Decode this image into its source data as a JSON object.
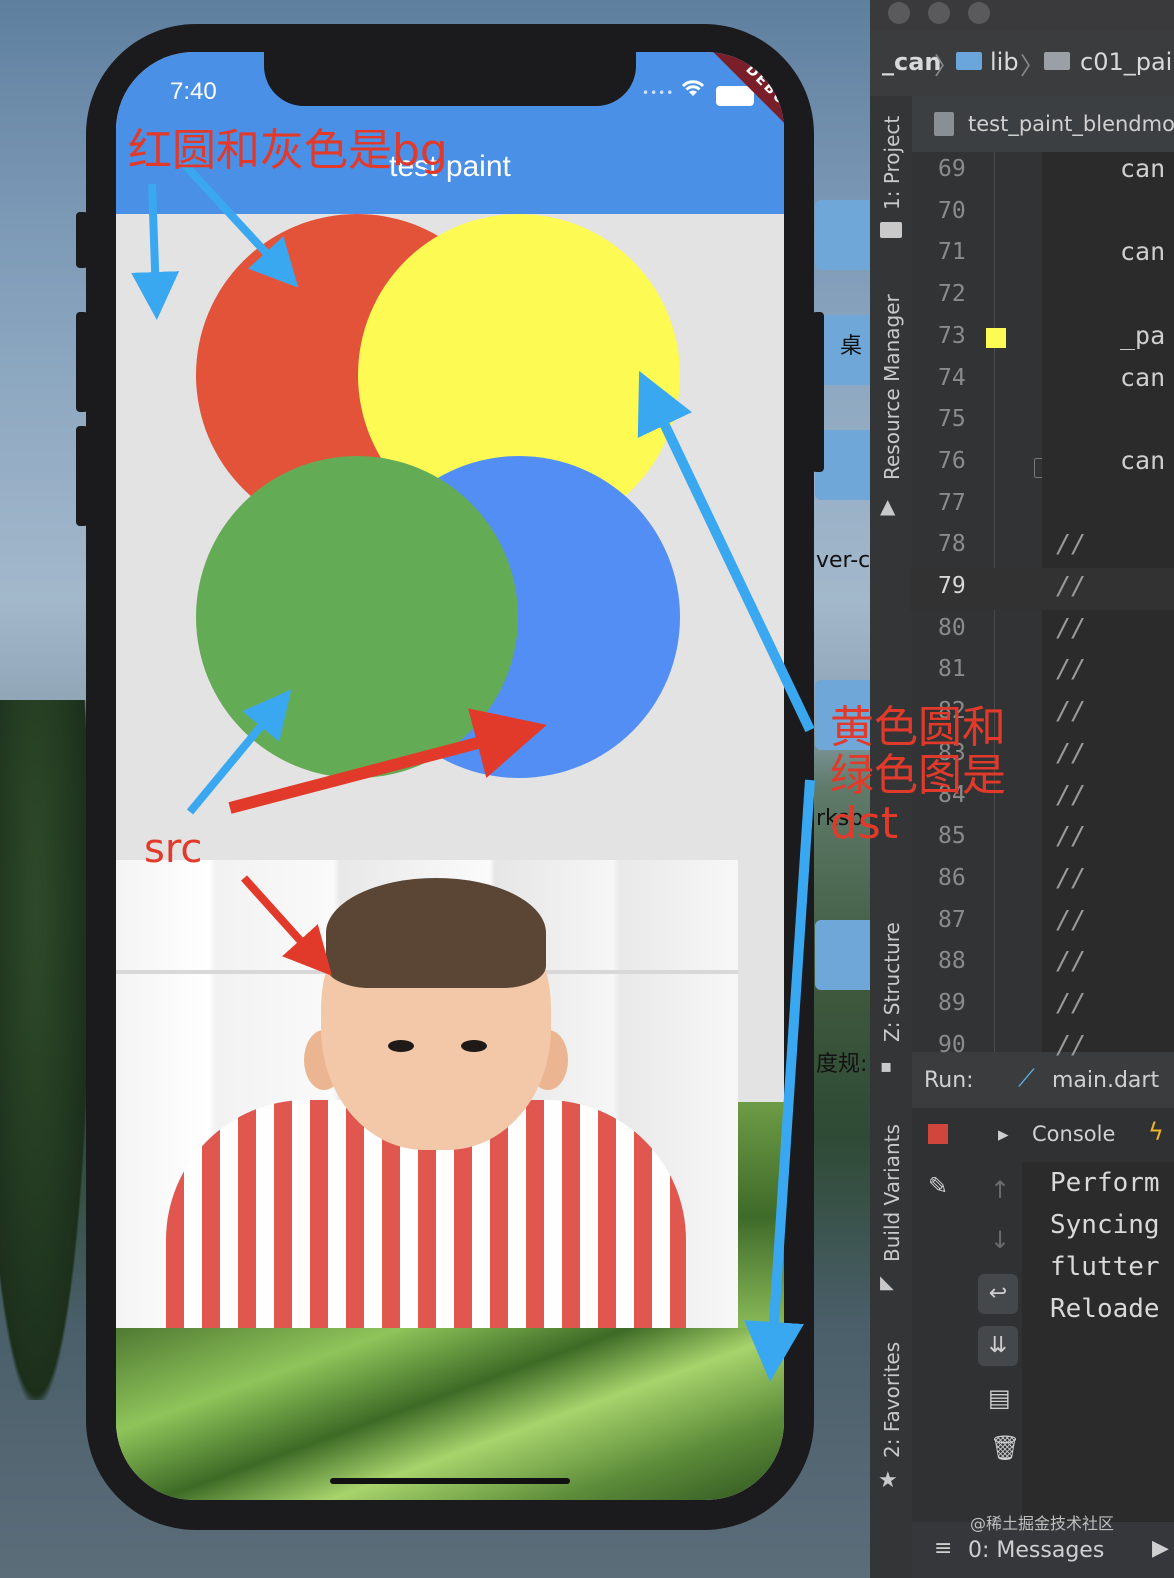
{
  "phone": {
    "status_time": "7:40",
    "debug_banner": "DEBUG",
    "app_title": "test paint"
  },
  "annotations": {
    "bg_note": "红圆和灰色是bg",
    "src_note": "src",
    "dst_note_line1": "黄色圆和",
    "dst_note_line2": "绿色图是",
    "dst_note_line3": "dst"
  },
  "desktop_labels": {
    "label_1": "桌",
    "label_2": "ver-c",
    "label_3": "rksp",
    "label_4": "度规:"
  },
  "ide": {
    "breadcrumb": [
      "_can",
      "lib",
      "c01_pai"
    ],
    "file_tab": "test_paint_blendmo",
    "side_tabs": {
      "project": "1: Project",
      "resource_manager": "Resource Manager",
      "structure": "Z: Structure",
      "build_variants": "Build Variants",
      "favorites": "2: Favorites"
    },
    "line_numbers": [
      "69",
      "70",
      "71",
      "72",
      "73",
      "74",
      "75",
      "76",
      "77",
      "78",
      "79",
      "80",
      "81",
      "82",
      "83",
      "84",
      "85",
      "86",
      "87",
      "88",
      "89",
      "90"
    ],
    "code_lines": {
      "69": "can",
      "71": "can",
      "73": "_pa",
      "74": "can",
      "76": "can",
      "78": "//",
      "79": "//",
      "80": "//",
      "81": "//",
      "82": "//",
      "83": "//",
      "84": "//",
      "85": "//",
      "86": "//",
      "87": "//",
      "88": "//",
      "89": "//",
      "90": "//"
    },
    "gutter_color_swatch": "#fdfb53",
    "run_label": "Run:",
    "run_config": "main.dart",
    "console_tab": "Console",
    "console_lines": [
      "Perform",
      "Syncing",
      "flutter",
      "Reloade"
    ],
    "messages_tab": "0: Messages",
    "watermark": "@稀土掘金技术社区"
  },
  "colors": {
    "red_circle": "#e3533a",
    "yellow_circle": "#fdfb53",
    "green_circle": "#64ab56",
    "blue_circle": "#528ef4",
    "appbar": "#4a90e6",
    "annotation_red": "#e23a2a",
    "annotation_blue": "#3aa8f0"
  }
}
